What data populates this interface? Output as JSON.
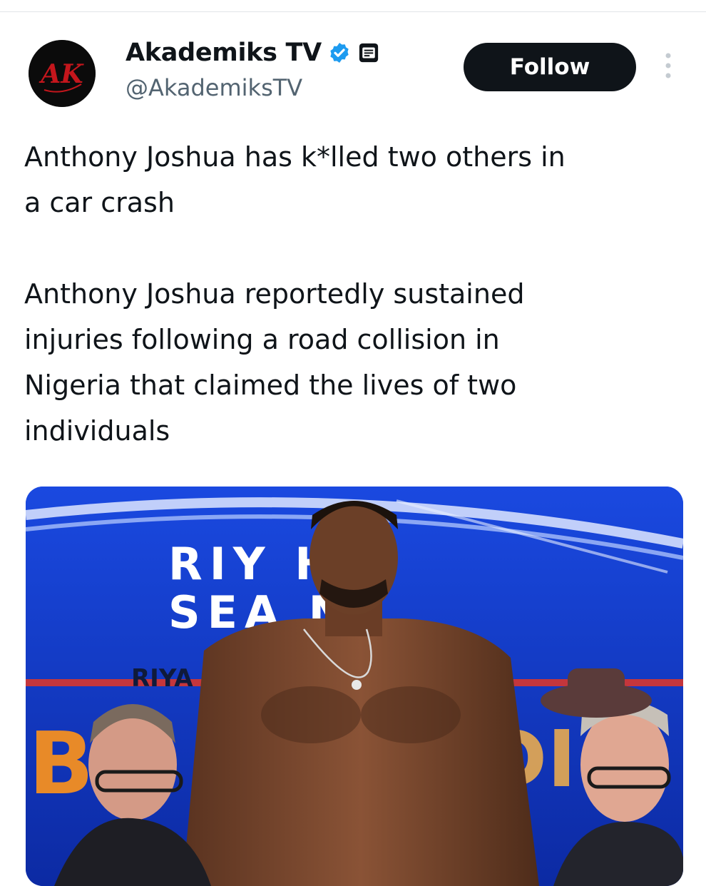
{
  "author": {
    "display_name": "Akademiks TV",
    "handle": "@AkademiksTV",
    "avatar_text": "AK",
    "verified": true,
    "verified_color": "#1d9bf0"
  },
  "actions": {
    "follow_label": "Follow",
    "more_icon": "more-dots-icon"
  },
  "tweet": {
    "text": "Anthony Joshua has k*lled two others in\na car crash\n\nAnthony Joshua reportedly sustained\ninjuries following a road collision in\nNigeria that claimed the lives of two\nindividuals"
  },
  "media": {
    "banner_line_1": "RIY   H",
    "banner_line_2": "SEA    N",
    "banner_small": "RIYA",
    "banner_large": "B",
    "banner_right": "DI"
  }
}
